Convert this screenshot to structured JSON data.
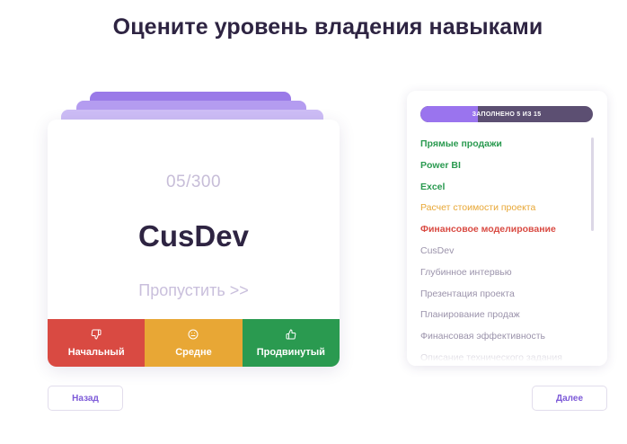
{
  "header": {
    "title": "Оцените уровень владения навыками"
  },
  "card": {
    "counter": "05/300",
    "skill": "CusDev",
    "skip_label": "Пропустить >>",
    "levels": [
      {
        "label": "Начальный",
        "icon": "thumbs-down-icon",
        "color": "#d94a42"
      },
      {
        "label": "Средне",
        "icon": "neutral-face-icon",
        "color": "#e8a735"
      },
      {
        "label": "Продвинутый",
        "icon": "thumbs-up-icon",
        "color": "#2a9a50"
      }
    ]
  },
  "progress": {
    "label": "ЗАПОЛНЕНО 5 ИЗ 15",
    "filled": 5,
    "total": 15
  },
  "skills": [
    {
      "name": "Прямые продажи",
      "status": "advanced"
    },
    {
      "name": "Power BI",
      "status": "advanced"
    },
    {
      "name": "Excel",
      "status": "advanced"
    },
    {
      "name": "Расчет стоимости проекта",
      "status": "medium"
    },
    {
      "name": "Финансовое моделирование",
      "status": "beginner"
    },
    {
      "name": "CusDev",
      "status": "pending"
    },
    {
      "name": "Глубинное интервью",
      "status": "pending"
    },
    {
      "name": "Презентация проекта",
      "status": "pending"
    },
    {
      "name": "Планирование продаж",
      "status": "pending"
    },
    {
      "name": "Финансовая эффективность",
      "status": "pending"
    },
    {
      "name": "Описание технического задания",
      "status": "pending"
    }
  ],
  "nav": {
    "back_label": "Назад",
    "next_label": "Далее"
  },
  "colors": {
    "accent": "#9a74ee",
    "advanced": "#2a9a50",
    "medium": "#e8a735",
    "beginner": "#d94a42",
    "pending": "#9b93ab"
  }
}
